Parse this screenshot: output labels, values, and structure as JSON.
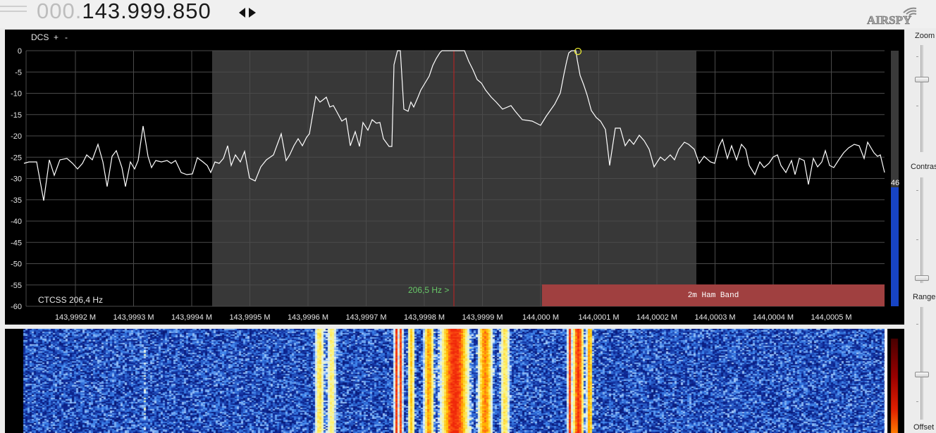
{
  "header": {
    "frequency_prefix": "000.",
    "frequency_main": "143.999.850",
    "logo_text": "AIRSPY"
  },
  "spectrum": {
    "dcs_label": "DCS",
    "dcs_plus": "+",
    "dcs_minus": "-",
    "ctcss_label": "CTCSS  206,4 Hz",
    "tone_label": "206,5 Hz >",
    "band_label": "2m Ham Band",
    "y_ticks": [
      "0",
      "-5",
      "-10",
      "-15",
      "-20",
      "-25",
      "-30",
      "-35",
      "-40",
      "-45",
      "-50",
      "-55",
      "-60"
    ],
    "x_ticks": [
      "143,9992 M",
      "143,9993 M",
      "143,9994 M",
      "143,9995 M",
      "143,9996 M",
      "143,9997 M",
      "143,9998 M",
      "143,9999 M",
      "144,000 M",
      "144,0001 M",
      "144,0002 M",
      "144,0003 M",
      "144,0004 M",
      "144,0005 M"
    ],
    "level_value": "46"
  },
  "side_controls": {
    "zoom_label": "Zoom",
    "contrast_label": "Contras",
    "range_label": "Range",
    "offset_label": "Offset"
  },
  "colors": {
    "passband": "#383838",
    "band_plan": "#a04040",
    "tuning_line": "#c62020",
    "trace": "#ffffff",
    "grid": "#4a4a4a",
    "level_bar": "#1744c4"
  }
}
